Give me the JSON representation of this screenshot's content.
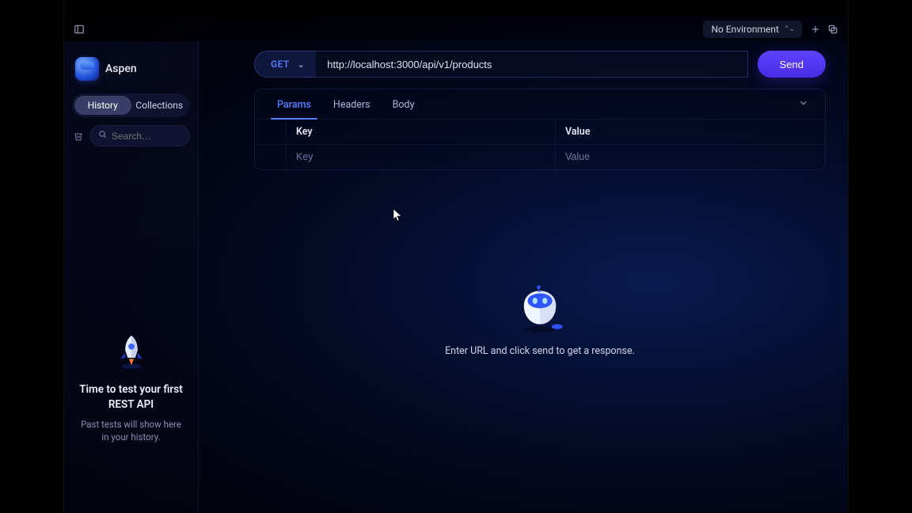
{
  "app": {
    "name": "Aspen"
  },
  "toolbar": {
    "environment_label": "No Environment"
  },
  "sidebar": {
    "tabs": {
      "history": "History",
      "collections": "Collections",
      "active": "history"
    },
    "search_placeholder": "Search…",
    "empty": {
      "title": "Time to test your first REST API",
      "subtitle": "Past tests will show here in your history."
    }
  },
  "request": {
    "method": "GET",
    "url": "http://localhost:3000/api/v1/products",
    "send_label": "Send",
    "tabs": [
      "Params",
      "Headers",
      "Body"
    ],
    "active_tab": "Params",
    "kv": {
      "key_header": "Key",
      "value_header": "Value",
      "key_placeholder": "Key",
      "value_placeholder": "Value"
    }
  },
  "response": {
    "empty_message": "Enter URL and click send to get a response."
  }
}
